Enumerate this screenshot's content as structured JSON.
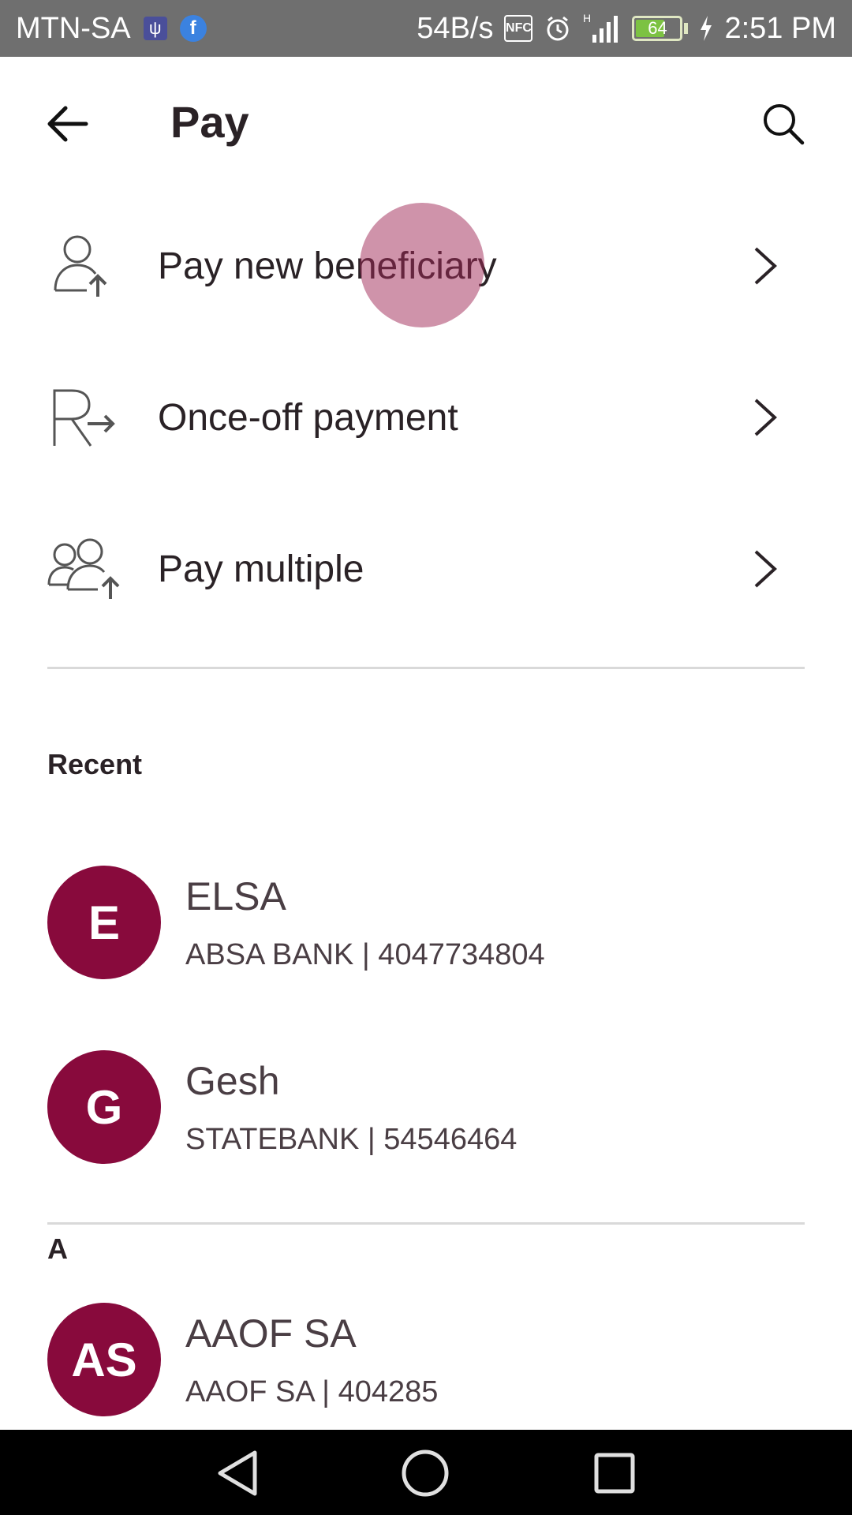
{
  "status_bar": {
    "carrier": "MTN-SA",
    "net_speed": "54B/s",
    "nfc": "NFC",
    "signal_type": "H",
    "battery": "64",
    "time": "2:51 PM",
    "battery_color": "#7cc242"
  },
  "header": {
    "title": "Pay",
    "back_icon": "arrow-left-icon",
    "search_icon": "search-icon"
  },
  "actions": [
    {
      "label": "Pay new beneficiary",
      "icon": "person-upload-icon"
    },
    {
      "label": "Once-off payment",
      "icon": "rand-arrow-icon"
    },
    {
      "label": "Pay multiple",
      "icon": "group-upload-icon"
    }
  ],
  "recent": {
    "title": "Recent",
    "items": [
      {
        "initials": "E",
        "name": "ELSA",
        "detail": "ABSA BANK | 4047734804"
      },
      {
        "initials": "G",
        "name": "Gesh",
        "detail": "STATEBANK | 54546464"
      }
    ]
  },
  "alpha_section": {
    "letter": "A",
    "items": [
      {
        "initials": "AS",
        "name": "AAOF SA",
        "detail": "AAOF SA | 404285"
      }
    ]
  },
  "colors": {
    "avatar_bg": "#880a3c",
    "ripple": "#a02855",
    "status_bar_bg": "#6f6f6f"
  }
}
